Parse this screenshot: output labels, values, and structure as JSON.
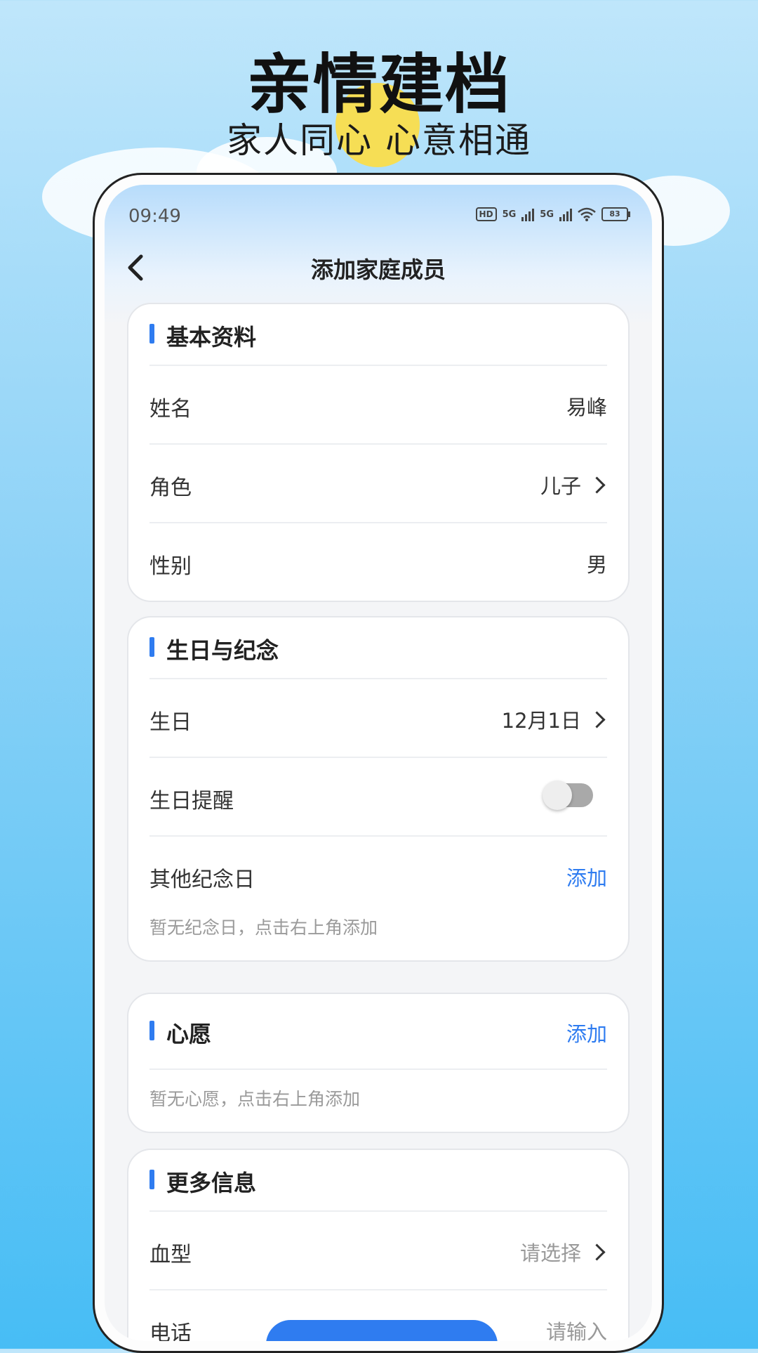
{
  "promo": {
    "headline": "亲情建档",
    "subline": "家人同心   心意相通"
  },
  "status_bar": {
    "time": "09:49",
    "hd_label": "HD",
    "net1": "5G",
    "net2": "5G",
    "battery": "83"
  },
  "nav": {
    "back_icon": "chevron-left-icon",
    "title": "添加家庭成员"
  },
  "sections": {
    "basic": {
      "title": "基本资料",
      "rows": [
        {
          "label": "姓名",
          "value": "易峰"
        },
        {
          "label": "角色",
          "value": "儿子"
        },
        {
          "label": "性别",
          "value": "男"
        }
      ]
    },
    "birthday": {
      "title": "生日与纪念",
      "birthday_label": "生日",
      "birthday_value": "12月1日",
      "reminder_label": "生日提醒",
      "reminder_on": false,
      "anniv_label": "其他纪念日",
      "anniv_action": "添加",
      "anniv_empty": "暂无纪念日，点击右上角添加"
    },
    "wish": {
      "title": "心愿",
      "action": "添加",
      "empty": "暂无心愿，点击右上角添加"
    },
    "more": {
      "title": "更多信息",
      "blood_label": "血型",
      "blood_placeholder": "请选择",
      "phone_label": "电话",
      "phone_placeholder": "请输入"
    }
  },
  "colors": {
    "accent": "#2f7cf0",
    "sun": "#f6de55"
  }
}
